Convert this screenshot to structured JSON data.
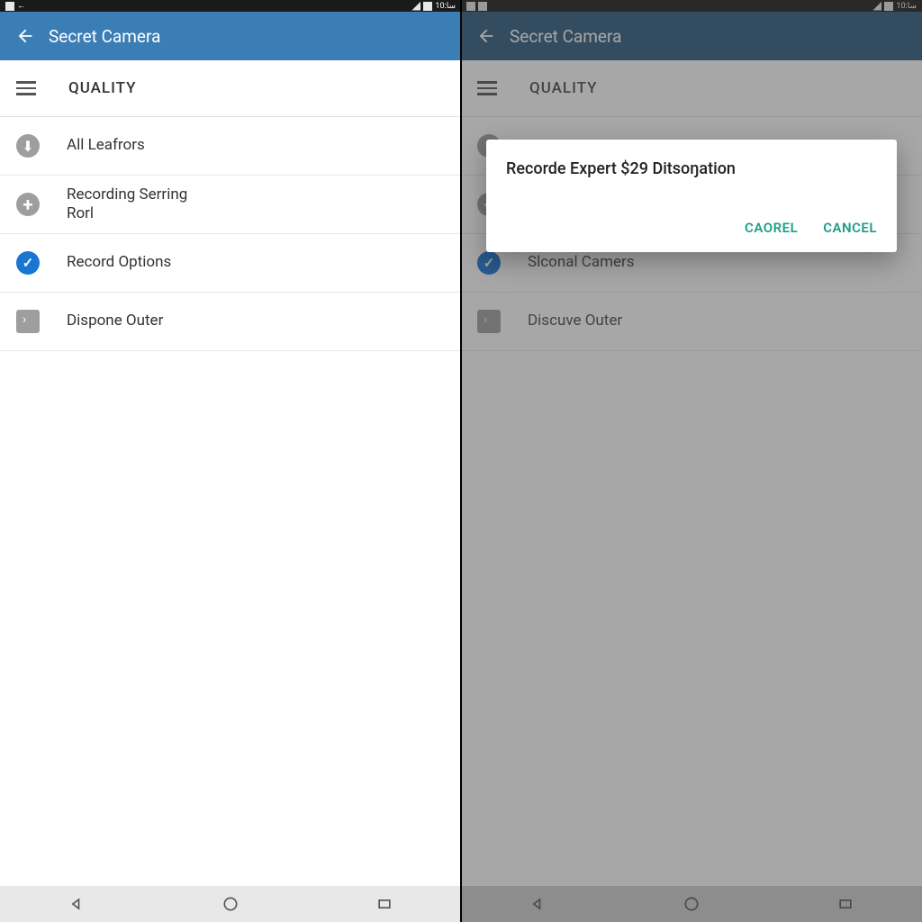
{
  "statusbar": {
    "time_left": "10:سا",
    "time_right": "10:سا"
  },
  "appbar": {
    "title": "Secret Camera"
  },
  "section": {
    "heading": "QUALITY"
  },
  "left_rows": [
    {
      "label": "All Leafrors",
      "icon": "gray"
    },
    {
      "label": "Recording Serring\nRorl",
      "icon": "plus"
    },
    {
      "label": "Record Options",
      "icon": "check"
    },
    {
      "label": "Dispone Outer",
      "icon": "box"
    }
  ],
  "right_rows": [
    {
      "label": "",
      "icon": "gray"
    },
    {
      "label": "",
      "icon": "plus"
    },
    {
      "label": "Slconal Camers",
      "icon": "check"
    },
    {
      "label": "Discuve Outer",
      "icon": "box"
    }
  ],
  "dialog": {
    "title": "Recorde Expert $29 Ditsoŋation",
    "action1": "CAOREL",
    "action2": "CANCEL"
  }
}
